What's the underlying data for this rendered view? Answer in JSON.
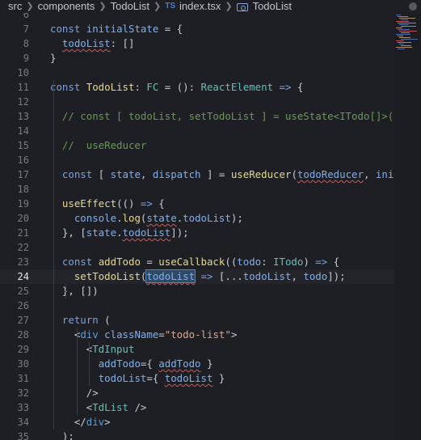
{
  "breadcrumb": {
    "items": [
      "src",
      "components",
      "TodoList",
      "index.tsx",
      "TodoList"
    ],
    "ts_icon": "TS",
    "symbol_icon": "symbol-icon"
  },
  "editor": {
    "active_line": 24,
    "lines": [
      {
        "n": "6",
        "tokens": []
      },
      {
        "n": "7",
        "tokens": [
          [
            "kw",
            "const "
          ],
          [
            "id",
            "initialState"
          ],
          [
            "pl",
            " = {"
          ]
        ]
      },
      {
        "n": "8",
        "tokens": [
          [
            "pl",
            "  "
          ],
          [
            "id",
            "todoList"
          ],
          [
            "pl",
            ": []"
          ]
        ]
      },
      {
        "n": "9",
        "tokens": [
          [
            "pl",
            "}"
          ]
        ]
      },
      {
        "n": "10",
        "tokens": []
      },
      {
        "n": "11",
        "tokens": [
          [
            "kw",
            "const "
          ],
          [
            "fn",
            "TodoList"
          ],
          [
            "pl",
            ": "
          ],
          [
            "ty",
            "FC"
          ],
          [
            "pl",
            " = (): "
          ],
          [
            "ty",
            "ReactElement"
          ],
          [
            "kw",
            " => "
          ],
          [
            "pl",
            "{"
          ]
        ]
      },
      {
        "n": "12",
        "tokens": []
      },
      {
        "n": "13",
        "tokens": [
          [
            "cm",
            "  // const [ todoList, setTodoList ] = useState<ITodo[]>([]"
          ]
        ]
      },
      {
        "n": "14",
        "tokens": []
      },
      {
        "n": "15",
        "tokens": [
          [
            "cm",
            "  //  useReducer"
          ]
        ]
      },
      {
        "n": "16",
        "tokens": []
      },
      {
        "n": "17",
        "tokens": [
          [
            "kw",
            "  const "
          ],
          [
            "pl",
            "[ "
          ],
          [
            "id",
            "state"
          ],
          [
            "pl",
            ", "
          ],
          [
            "id",
            "dispatch"
          ],
          [
            "pl",
            " ] = "
          ],
          [
            "fn",
            "useReducer"
          ],
          [
            "pl",
            "("
          ],
          [
            "id",
            "todoReducer"
          ],
          [
            "pl",
            ", "
          ],
          [
            "id",
            "initi"
          ]
        ]
      },
      {
        "n": "18",
        "tokens": []
      },
      {
        "n": "19",
        "tokens": [
          [
            "pl",
            "  "
          ],
          [
            "fn",
            "useEffect"
          ],
          [
            "pl",
            "(() "
          ],
          [
            "kw",
            "=> "
          ],
          [
            "pl",
            "{"
          ]
        ]
      },
      {
        "n": "20",
        "tokens": [
          [
            "pl",
            "    "
          ],
          [
            "id",
            "console"
          ],
          [
            "pl",
            "."
          ],
          [
            "fn",
            "log"
          ],
          [
            "pl",
            "("
          ],
          [
            "id",
            "state"
          ],
          [
            "pl",
            "."
          ],
          [
            "id",
            "todoList"
          ],
          [
            "pl",
            ");"
          ]
        ]
      },
      {
        "n": "21",
        "tokens": [
          [
            "pl",
            "  }, ["
          ],
          [
            "id",
            "state"
          ],
          [
            "pl",
            "."
          ],
          [
            "id",
            "todoList"
          ],
          [
            "pl",
            "]);"
          ]
        ]
      },
      {
        "n": "22",
        "tokens": []
      },
      {
        "n": "23",
        "tokens": [
          [
            "kw",
            "  const "
          ],
          [
            "fn",
            "addTodo"
          ],
          [
            "pl",
            " = "
          ],
          [
            "fn",
            "useCallback"
          ],
          [
            "pl",
            "(("
          ],
          [
            "id",
            "todo"
          ],
          [
            "pl",
            ": "
          ],
          [
            "ty",
            "ITodo"
          ],
          [
            "pl",
            ") "
          ],
          [
            "kw",
            "=> "
          ],
          [
            "pl",
            "{"
          ]
        ]
      },
      {
        "n": "24",
        "tokens": [
          [
            "pl",
            "    "
          ],
          [
            "fn",
            "setTodoList"
          ],
          [
            "pl",
            "("
          ],
          [
            "id",
            "todoList"
          ],
          [
            "kw",
            " => "
          ],
          [
            "pl",
            "[..."
          ],
          [
            "id",
            "todoList"
          ],
          [
            "pl",
            ", "
          ],
          [
            "id",
            "todo"
          ],
          [
            "pl",
            "]);"
          ]
        ]
      },
      {
        "n": "25",
        "tokens": [
          [
            "pl",
            "  }, [])"
          ]
        ]
      },
      {
        "n": "26",
        "tokens": []
      },
      {
        "n": "27",
        "tokens": [
          [
            "kw",
            "  return "
          ],
          [
            "pl",
            "("
          ]
        ]
      },
      {
        "n": "28",
        "tokens": [
          [
            "pl",
            "    <"
          ],
          [
            "tag",
            "div "
          ],
          [
            "jsx",
            "className"
          ],
          [
            "pl",
            "="
          ],
          [
            "str",
            "\"todo-list\""
          ],
          [
            "pl",
            ">"
          ]
        ]
      },
      {
        "n": "29",
        "tokens": [
          [
            "pl",
            "      <"
          ],
          [
            "ty",
            "TdInput"
          ]
        ]
      },
      {
        "n": "30",
        "tokens": [
          [
            "pl",
            "        "
          ],
          [
            "jsx",
            "addTodo"
          ],
          [
            "pl",
            "={ "
          ],
          [
            "id",
            "addTodo"
          ],
          [
            "pl",
            " }"
          ]
        ]
      },
      {
        "n": "31",
        "tokens": [
          [
            "pl",
            "        "
          ],
          [
            "jsx",
            "todoList"
          ],
          [
            "pl",
            "={ "
          ],
          [
            "id",
            "todoList"
          ],
          [
            "pl",
            " }"
          ]
        ]
      },
      {
        "n": "32",
        "tokens": [
          [
            "pl",
            "      />"
          ]
        ]
      },
      {
        "n": "33",
        "tokens": [
          [
            "pl",
            "      <"
          ],
          [
            "ty",
            "TdList "
          ],
          [
            "pl",
            "/>"
          ]
        ]
      },
      {
        "n": "34",
        "tokens": [
          [
            "pl",
            "    </"
          ],
          [
            "tag",
            "div"
          ],
          [
            "pl",
            ">"
          ]
        ]
      },
      {
        "n": "35",
        "tokens": [
          [
            "pl",
            "  );"
          ]
        ]
      }
    ]
  }
}
